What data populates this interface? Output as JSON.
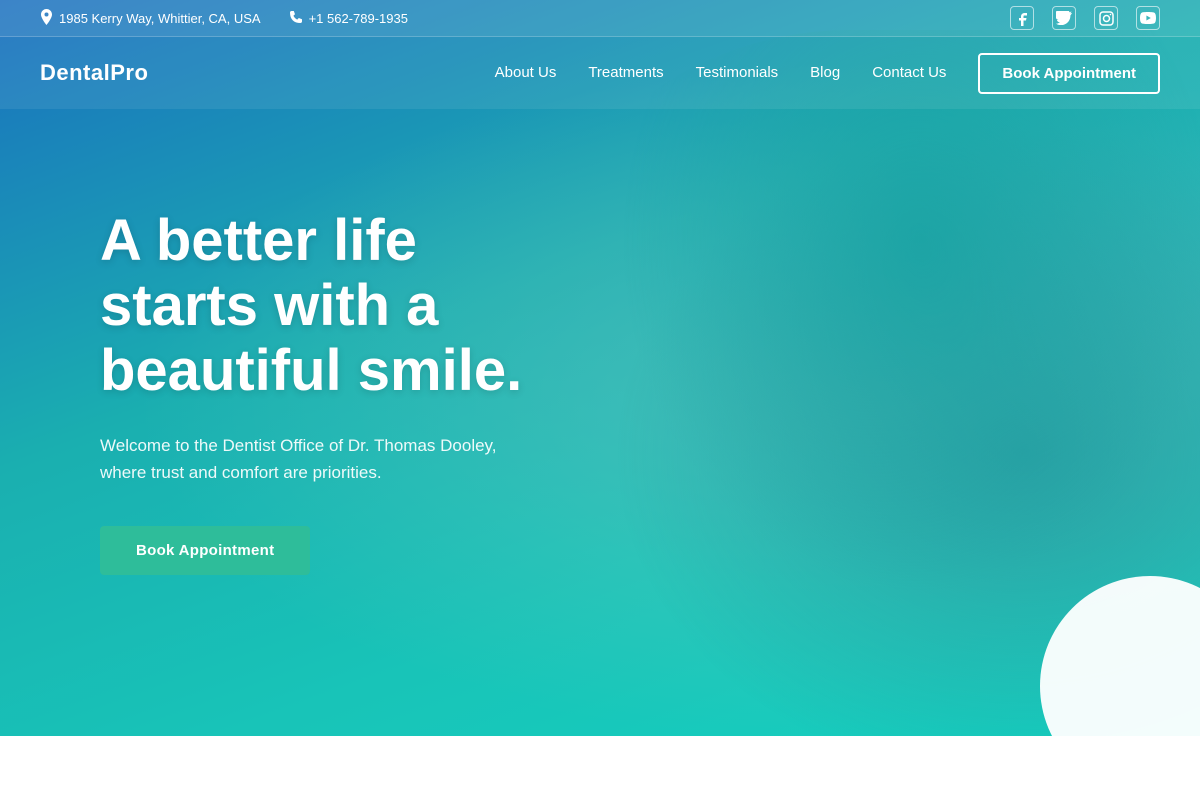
{
  "topbar": {
    "address": "1985 Kerry Way, Whittier, CA, USA",
    "phone": "+1 562-789-1935",
    "address_icon": "📍",
    "phone_icon": "📞"
  },
  "social": {
    "items": [
      {
        "name": "facebook-icon",
        "label": "f"
      },
      {
        "name": "twitter-icon",
        "label": "𝕏"
      },
      {
        "name": "instagram-icon",
        "label": "◎"
      },
      {
        "name": "youtube-icon",
        "label": "▶"
      }
    ]
  },
  "navbar": {
    "logo": "DentalPro",
    "links": [
      {
        "label": "About Us",
        "name": "nav-about"
      },
      {
        "label": "Treatments",
        "name": "nav-treatments"
      },
      {
        "label": "Testimonials",
        "name": "nav-testimonials"
      },
      {
        "label": "Blog",
        "name": "nav-blog"
      },
      {
        "label": "Contact Us",
        "name": "nav-contact"
      }
    ],
    "cta": "Book Appointment"
  },
  "hero": {
    "title": "A better life starts with a beautiful smile.",
    "subtitle": "Welcome to the Dentist Office of Dr. Thomas Dooley, where trust and comfort are priorities.",
    "cta": "Book Appointment"
  }
}
